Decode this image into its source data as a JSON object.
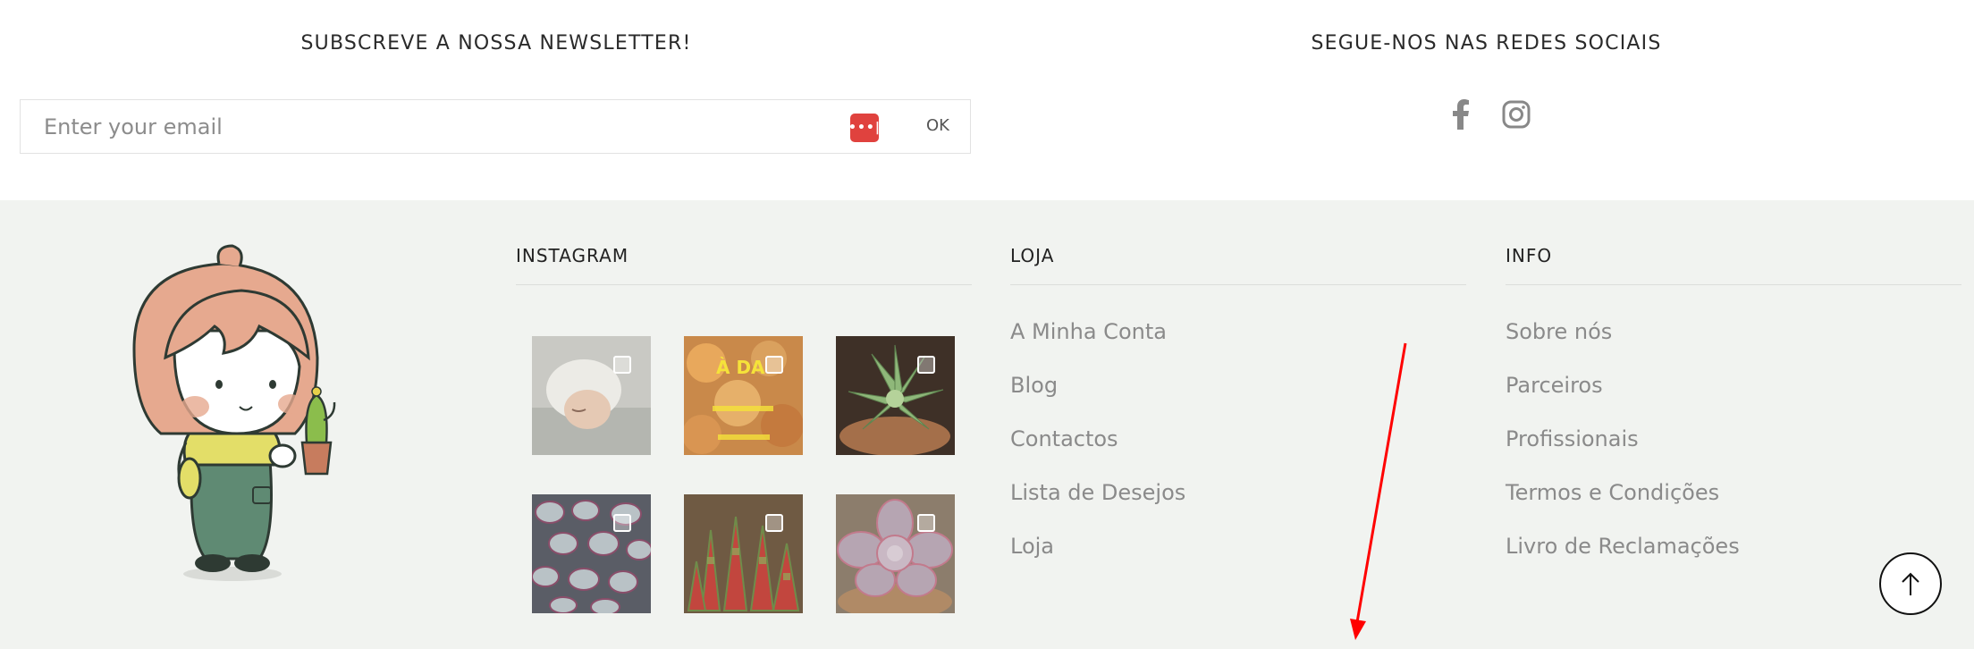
{
  "newsletter": {
    "title": "SUBSCREVE A NOSSA NEWSLETTER!",
    "email_placeholder": "Enter your email",
    "submit_label": "OK"
  },
  "social": {
    "title": "SEGUE-NOS NAS REDES SOCIAIS",
    "icons": [
      "facebook-icon",
      "instagram-icon"
    ]
  },
  "footer": {
    "instagram": {
      "title": "INSTAGRAM",
      "posts": [
        {
          "subject": "sleeping baby"
        },
        {
          "subject": "orange succulents with text",
          "overlay_text": "À DA"
        },
        {
          "subject": "green succulent"
        },
        {
          "subject": "speckled succulents"
        },
        {
          "subject": "red spiky succulents"
        },
        {
          "subject": "pink rosette succulent"
        }
      ]
    },
    "loja": {
      "title": "LOJA",
      "links": [
        "A Minha Conta",
        "Blog",
        "Contactos",
        "Lista de Desejos",
        "Loja"
      ]
    },
    "info": {
      "title": "INFO",
      "links": [
        "Sobre nós",
        "Parceiros",
        "Profissionais",
        "Termos e Condições",
        "Livro de Reclamações"
      ]
    }
  },
  "colors": {
    "footer_bg": "#f1f3f0",
    "link_text": "#8a8a8a",
    "password_manager_icon": "#e0423e",
    "annotation_arrow": "#ff0000"
  }
}
